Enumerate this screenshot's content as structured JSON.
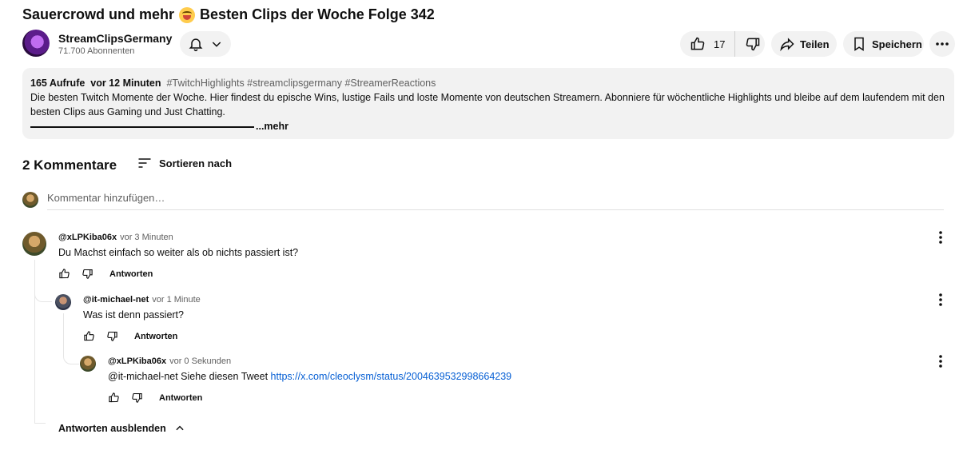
{
  "video": {
    "title": "Sauercrowd und mehr",
    "title_suffix": "Besten Clips der Woche Folge 342"
  },
  "channel": {
    "name": "StreamClipsGermany",
    "subscribers": "71.700 Abonnenten"
  },
  "actions": {
    "likes": "17",
    "share_label": "Teilen",
    "save_label": "Speichern"
  },
  "description": {
    "views": "165 Aufrufe",
    "time": "vor 12 Minuten",
    "tags": "#TwitchHighlights #streamclipsgermany #StreamerReactions",
    "text": "Die besten Twitch Momente der Woche. Hier findest du epische Wins, lustige Fails und loste Momente von deutschen Streamern. Abonniere für wöchentliche Highlights und bleibe auf dem laufendem mit den besten Clips aus Gaming und Just Chatting.",
    "more_label": "...mehr"
  },
  "comments_section": {
    "count_label": "2 Kommentare",
    "sort_label": "Sortieren nach",
    "add_placeholder": "Kommentar hinzufügen…",
    "hide_replies_label": "Antworten ausblenden",
    "reply_label": "Antworten"
  },
  "comments": [
    {
      "author": "@xLPKiba06x",
      "time": "vor 3 Minuten",
      "text": "Du Machst einfach so weiter als ob nichts passiert ist?"
    },
    {
      "author": "@it-michael-net",
      "time": "vor 1 Minute",
      "text": "Was ist denn passiert?"
    },
    {
      "author": "@xLPKiba06x",
      "time": "vor 0 Sekunden",
      "text": "@it-michael-net Siehe diesen Tweet",
      "link": "https://x.com/cleoclysm/status/2004639532998664239"
    }
  ],
  "icons": {
    "bell": "bell-icon",
    "chevron": "chevron-down-icon",
    "like": "thumb-up-icon",
    "dislike": "thumb-down-icon",
    "share": "share-icon",
    "save": "bookmark-icon",
    "more": "more-horizontal-icon",
    "sort": "sort-icon",
    "kebab": "more-vertical-icon",
    "collapse": "chevron-up-icon"
  },
  "colors": {
    "link": "#065fd4",
    "pill_bg": "#f2f2f2",
    "secondary_text": "#606060"
  }
}
